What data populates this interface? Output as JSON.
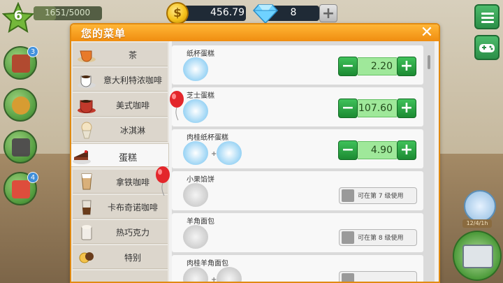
{
  "hud": {
    "level": "6",
    "xp_text": "1651/5000",
    "xp_progress": 0.3302,
    "coins": "456.79",
    "gems": "8"
  },
  "left_badges": [
    "3",
    "4"
  ],
  "right_tag": "12/4/1h",
  "dialog": {
    "title": "您的菜单"
  },
  "categories": [
    {
      "label": "茶",
      "icon": "tea-cup-icon"
    },
    {
      "label": "意大利特浓咖啡",
      "icon": "espresso-cup-icon"
    },
    {
      "label": "美式咖啡",
      "icon": "americano-cup-icon"
    },
    {
      "label": "冰淇淋",
      "icon": "ice-cream-icon"
    },
    {
      "label": "蛋糕",
      "icon": "cake-slice-icon",
      "active": true
    },
    {
      "label": "拿铁咖啡",
      "icon": "latte-glass-icon"
    },
    {
      "label": "卡布奇诺咖啡",
      "icon": "cappuccino-glass-icon"
    },
    {
      "label": "热巧克力",
      "icon": "hot-chocolate-icon"
    },
    {
      "label": "特别",
      "icon": "special-treats-icon"
    }
  ],
  "items": [
    {
      "name": "纸杯蛋糕",
      "price": "2.20",
      "icons": [
        "cupcake-icon"
      ]
    },
    {
      "name": "芝士蛋糕",
      "price": "107.60",
      "icons": [
        "cheesecake-icon"
      ]
    },
    {
      "name": "肉桂纸杯蛋糕",
      "price": "4.90",
      "icons": [
        "cupcake-icon",
        "cinnamon-icon"
      ]
    },
    {
      "name": "小果馅饼",
      "locked": "可在第 7 级使用",
      "icons": [
        "tart-icon"
      ]
    },
    {
      "name": "羊角面包",
      "locked": "可在第 8 级使用",
      "icons": [
        "croissant-icon"
      ]
    },
    {
      "name": "肉桂羊角面包",
      "locked": "",
      "icons": [
        "croissant-icon",
        "cinnamon-icon"
      ]
    }
  ]
}
